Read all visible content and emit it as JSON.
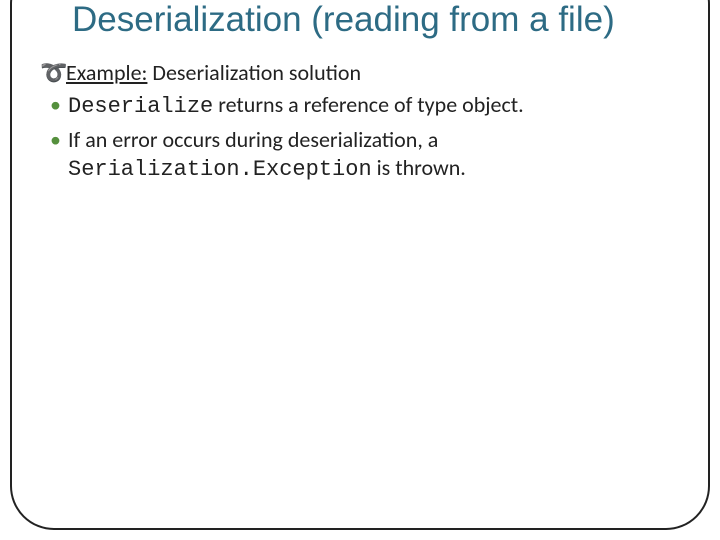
{
  "title": "Deserialization (reading from a file)",
  "example": {
    "label": "Example:",
    "rest": " Deserialization solution"
  },
  "items": [
    {
      "code": "Deserialize",
      "rest": " returns a reference of type object."
    },
    {
      "pre": "If an error occurs during deserialization, a ",
      "code": "Serialization.Exception",
      "post": " is thrown."
    }
  ]
}
